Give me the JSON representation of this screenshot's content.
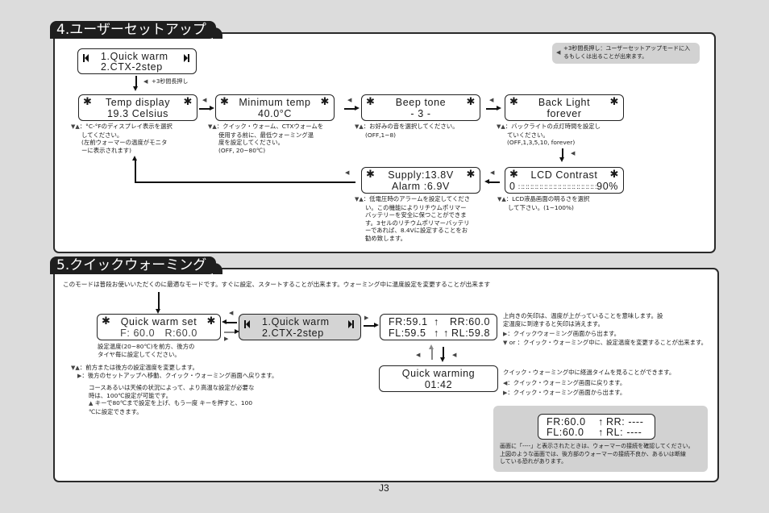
{
  "page_number": "J3",
  "icons": {
    "back": "◀",
    "next": "▶",
    "up": "▲",
    "down": "▼"
  },
  "section4": {
    "title": "4.ユーザーセットアップ",
    "tip": {
      "icon": "back-button-icon",
      "line1": "+3秒間長押し：ユーザーセットアップモードに入",
      "line2": "るもしくは出ることが出来ます。"
    },
    "menu_lcd": {
      "line1": "1.Quick warm",
      "line2": "2.CTX-2step"
    },
    "menu_arrow_label": "+3秒間長押し",
    "screens": [
      {
        "id": "temp-display",
        "line1": "Temp display",
        "line2": "19.3 Celsius",
        "note": [
          "：°C-°Fのディスプレイ表示を選択",
          "してください。",
          "(左前ウォーマーの温度がモニタ",
          "ーに表示されます)"
        ]
      },
      {
        "id": "minimum-temp",
        "line1": "Minimum temp",
        "line2": "40.0°C",
        "note": [
          "：クイック・ウォーム、CTXウォームを",
          "使用する前に、最低ウォーミング温",
          "度を設定してください。",
          "(OFF, 20~80℃)"
        ]
      },
      {
        "id": "beep-tone",
        "line1": "Beep tone",
        "line2": "- 3 -",
        "note": [
          "：お好みの音を選択してください。",
          "(OFF,1~8)"
        ]
      },
      {
        "id": "back-light",
        "line1": "Back Light",
        "line2": "forever",
        "note": [
          "：バックライトの点灯時間を設定し",
          "ていください。",
          "(OFF,1,3,5,10, forever)"
        ]
      },
      {
        "id": "lcd-contrast",
        "line1": "LCD Contrast",
        "line2_left": "0",
        "line2_right": "90%",
        "contrast_percent": 90,
        "note": [
          "：LCD液晶画面の明るさを選択",
          "して下さい。(1~100%)"
        ]
      },
      {
        "id": "supply-alarm",
        "line1": "Supply:13.8V",
        "line2": "Alarm :6.9V",
        "note": [
          "：低電圧時のアラームを設定してくださ",
          "い。この機能によりリチウムポリマー",
          "バッテリーを安全に保つことができま",
          "す。3セルのリチウムポリマーバッテリ",
          "ーであれば、8.4Vに設定することをお",
          "勧め致します。"
        ]
      }
    ]
  },
  "section5": {
    "title": "5.クイックウォーミング",
    "intro": "このモードは普段お使いいただくのに最適なモードです。すぐに設定、スタートすることが出来ます。ウォーミング中に温度設定を変更することが出来ます",
    "set_lcd": {
      "line1": "Quick warm set",
      "line2": "F: 60.0   R:60.0"
    },
    "set_notes": {
      "desc": [
        "設定温度(20~80℃)を前方、後方の",
        "タイヤ毎に設定してください。"
      ],
      "updown": "：前方または後方の設定温度を変更します。",
      "next": "：後方のセットアップへ移動、クイック・ウォーミング画面へ戻ります。",
      "extra": [
        "コースあるいは天候の状況によって、より高温な設定が必要な",
        "時は、100℃設定が可能です。",
        " キーで80℃まで設定を上げ、もう一度  キーを押すと、100",
        "℃に設定できます。"
      ]
    },
    "menu_lcd": {
      "line1": "1.Quick warm",
      "line2": "2.CTX-2step"
    },
    "status_lcd": {
      "line1_left": "FR:59.1",
      "line1_right": "RR:60.0",
      "line2_left": "FL:59.5",
      "line2_right": "RL:59.8"
    },
    "status_notes": {
      "desc": [
        "上向きの矢印は、温度が上がっていることを意味します。設",
        "定温度に到達すると矢印は消えます。"
      ],
      "next": "：クイックウォーミング画面から出ます。",
      "updown": " or  ：クイック・ウォーミング中に、設定温度を変更することが出来ます。"
    },
    "timer_lcd": {
      "line1": "Quick warming",
      "line2": "01:42"
    },
    "timer_notes": {
      "desc": "クイック・ウォーミング中に経過タイムを見ることができます。",
      "back": "：クイック・ウォーミング画面に戻ります。",
      "next": "：クイック・ウォーミング画面から出ます。"
    },
    "error_box": {
      "lcd": {
        "line1_left": "FR:60.0",
        "line1_right": "RR: ----",
        "line2_left": "FL:60.0",
        "line2_right": "RL: ----"
      },
      "text": [
        "画面に「----」と表示されたときは、ウォーマーの接続を確認してください。",
        "上図のような画面では、後方部のウォーマーの接続不良か、あるいは断線",
        "している恐れがあります。"
      ]
    }
  }
}
